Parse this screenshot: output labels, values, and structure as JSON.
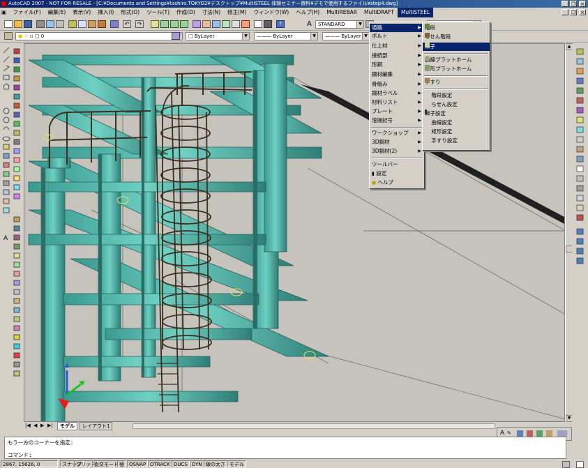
{
  "title_bar": {
    "text": "AutoCAD 2007 - NOT FOR RESALE - [C:¥Documents and Settings¥tashiro.TOKYO2¥デスクトップ¥MultiSTEEL 体験セミナー資料¥デモで使用するファイル¥step4.dwg]"
  },
  "menu_bar": {
    "items": [
      "ファイル(F)",
      "編集(E)",
      "表示(V)",
      "挿入(I)",
      "形式(O)",
      "ツール(T)",
      "作成(D)",
      "寸法(N)",
      "修正(M)",
      "ウィンドウ(W)",
      "ヘルプ(H)",
      "MultiREBAR",
      "MultiDRAFT",
      "MultiSTEEL"
    ]
  },
  "toolbar": {
    "text_style": "STANDARD",
    "layer": "0",
    "color": "ByLayer",
    "linetype": "ByLayer",
    "lineweight": "ByLayer"
  },
  "steel_menu": {
    "items": [
      {
        "label": "通路",
        "submenu": true,
        "selected": true
      },
      {
        "label": "ボルト",
        "submenu": true
      },
      {
        "label": "仕上材",
        "submenu": true
      },
      {
        "label": "接続部",
        "submenu": true
      },
      {
        "label": "形鋼",
        "submenu": true
      },
      {
        "label": "鋼材編集",
        "submenu": true
      },
      {
        "label": "骨組み",
        "submenu": true
      },
      {
        "label": "鋼材ラベル",
        "submenu": true
      },
      {
        "label": "材料リスト",
        "submenu": true
      },
      {
        "label": "プレート",
        "submenu": true
      },
      {
        "label": "溶接記号",
        "submenu": true
      },
      {
        "label": "ワークショップ",
        "submenu": true
      },
      {
        "label": "3D鋼材",
        "submenu": true
      },
      {
        "label": "3D鋼材(2)",
        "submenu": true
      },
      {
        "label": "ツールバー",
        "submenu": false
      },
      {
        "label": "設定",
        "submenu": false
      },
      {
        "label": "ヘルプ",
        "submenu": false
      }
    ]
  },
  "path_submenu": {
    "items": [
      {
        "label": "階段",
        "icon": "stair-icon"
      },
      {
        "label": "らせん階段",
        "icon": "spiral-stair-icon"
      },
      {
        "label": "梯子",
        "icon": "ladder-icon",
        "selected": true
      },
      {
        "label": "曲線プラットホーム",
        "icon": "curved-platform-icon"
      },
      {
        "label": "矩形プラットホーム",
        "icon": "rect-platform-icon"
      },
      {
        "label": "手すり",
        "icon": "handrail-icon"
      },
      {
        "label": "階段設定",
        "icon": ""
      },
      {
        "label": "らせん設定",
        "icon": ""
      },
      {
        "label": "梯子設定",
        "icon": "ladder-settings-icon"
      },
      {
        "label": "曲線設定",
        "icon": ""
      },
      {
        "label": "矩形設定",
        "icon": ""
      },
      {
        "label": "手すり設定",
        "icon": ""
      }
    ]
  },
  "layout_tabs": [
    "モデル",
    "レイアウト1"
  ],
  "command_line": {
    "history": "もう一方のコーナーを指定:",
    "prompt": "コマンド:"
  },
  "status_bar": {
    "coords": "2867, 15626, 0",
    "toggles": [
      "スナップ",
      "グリッド",
      "直交モード",
      "極",
      "OSNAP",
      "OTRACK",
      "DUCS",
      "DYN",
      "線の太さ",
      "モデル"
    ]
  },
  "colors": {
    "steel": "#4fb5a8",
    "steel_dark": "#2a6e66",
    "rail": "#3a3020",
    "highlight": "#0a246a",
    "viewport_bg": "#c6c3bc"
  }
}
